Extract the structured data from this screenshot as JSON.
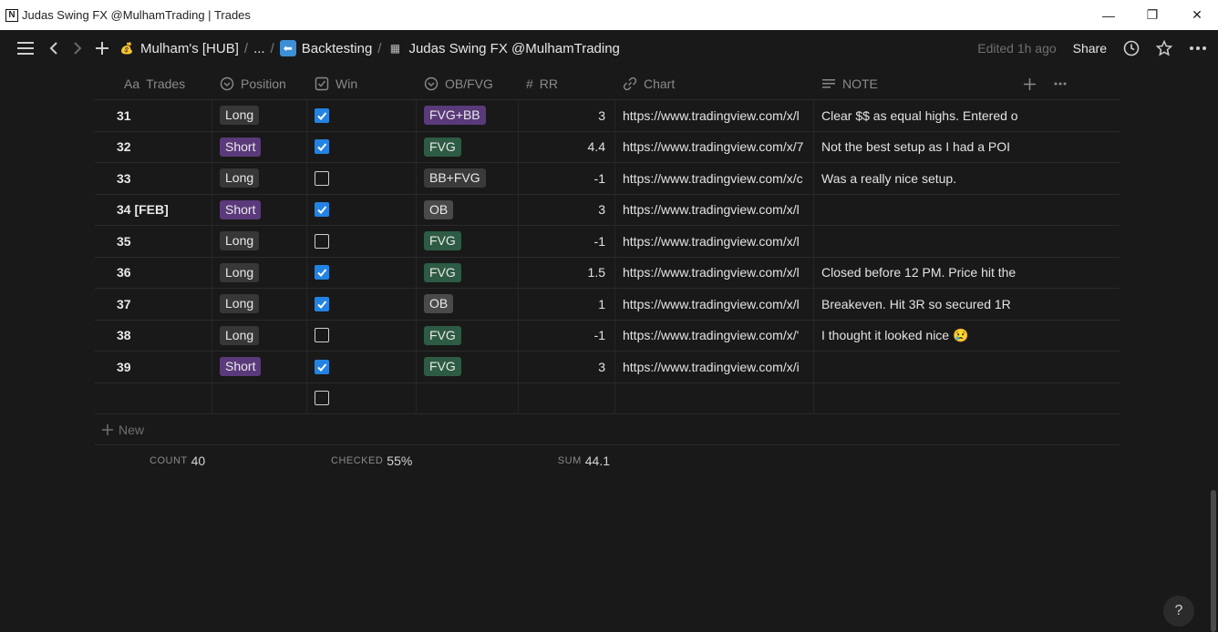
{
  "window": {
    "title": "Judas Swing FX @MulhamTrading | Trades",
    "app_icon": "N",
    "controls": {
      "minimize": "—",
      "restore": "❐",
      "close": "✕"
    }
  },
  "topbar": {
    "breadcrumbs": [
      {
        "label": "Mulham's [HUB]",
        "icon": "money-bag-icon",
        "emoji": "💰"
      },
      {
        "label": "...",
        "icon": ""
      },
      {
        "label": "Backtesting",
        "icon": "back-arrow-icon",
        "emoji": "⬅"
      },
      {
        "label": "Judas Swing FX @MulhamTrading",
        "icon": "checkered-page-icon",
        "emoji": "▦"
      }
    ],
    "edited": "Edited 1h ago",
    "share": "Share"
  },
  "columns": {
    "trades": {
      "label": "Trades",
      "icon": "title-icon",
      "glyph": "Aa"
    },
    "position": {
      "label": "Position",
      "icon": "select-icon"
    },
    "win": {
      "label": "Win",
      "icon": "checkbox-icon"
    },
    "ob_fvg": {
      "label": "OB/FVG",
      "icon": "select-icon"
    },
    "rr": {
      "label": "RR",
      "icon": "number-icon",
      "glyph": "#"
    },
    "chart": {
      "label": "Chart",
      "icon": "link-icon"
    },
    "note": {
      "label": "NOTE",
      "icon": "text-icon"
    }
  },
  "colors": {
    "long": "#373737",
    "short": "#5a3a7a",
    "fvg": "#2d5b43",
    "ob": "#4a4a4a",
    "bbfvg": "#3a3a3a",
    "fvgbb": "#5a3a7a",
    "check": "#2383e2"
  },
  "rows": [
    {
      "trade": "31",
      "position": "Long",
      "win": true,
      "ob": "FVG+BB",
      "rr": "3",
      "chart": "https://www.tradingview.com/x/l",
      "note": "Clear $$ as equal highs. Entered o"
    },
    {
      "trade": "32",
      "position": "Short",
      "win": true,
      "ob": "FVG",
      "rr": "4.4",
      "chart": "https://www.tradingview.com/x/7",
      "note": "Not the best setup as I had a POI"
    },
    {
      "trade": "33",
      "position": "Long",
      "win": false,
      "ob": "BB+FVG",
      "rr": "-1",
      "chart": "https://www.tradingview.com/x/c",
      "note": "Was a really nice setup."
    },
    {
      "trade": "34 [FEB]",
      "position": "Short",
      "win": true,
      "ob": "OB",
      "rr": "3",
      "chart": "https://www.tradingview.com/x/l",
      "note": ""
    },
    {
      "trade": "35",
      "position": "Long",
      "win": false,
      "ob": "FVG",
      "rr": "-1",
      "chart": "https://www.tradingview.com/x/l",
      "note": ""
    },
    {
      "trade": "36",
      "position": "Long",
      "win": true,
      "ob": "FVG",
      "rr": "1.5",
      "chart": "https://www.tradingview.com/x/l",
      "note": "Closed before 12 PM. Price hit the"
    },
    {
      "trade": "37",
      "position": "Long",
      "win": true,
      "ob": "OB",
      "rr": "1",
      "chart": "https://www.tradingview.com/x/l",
      "note": "Breakeven. Hit 3R so secured 1R"
    },
    {
      "trade": "38",
      "position": "Long",
      "win": false,
      "ob": "FVG",
      "rr": "-1",
      "chart": "https://www.tradingview.com/x/'",
      "note": "I thought it looked nice 😢"
    },
    {
      "trade": "39",
      "position": "Short",
      "win": true,
      "ob": "FVG",
      "rr": "3",
      "chart": "https://www.tradingview.com/x/i",
      "note": ""
    },
    {
      "trade": "",
      "position": "",
      "win": false,
      "ob": "",
      "rr": "",
      "chart": "",
      "note": ""
    }
  ],
  "new_row": "New",
  "footer": {
    "count_label": "COUNT",
    "count_value": "40",
    "checked_label": "CHECKED",
    "checked_value": "55%",
    "sum_label": "SUM",
    "sum_value": "44.1"
  },
  "help": "?"
}
